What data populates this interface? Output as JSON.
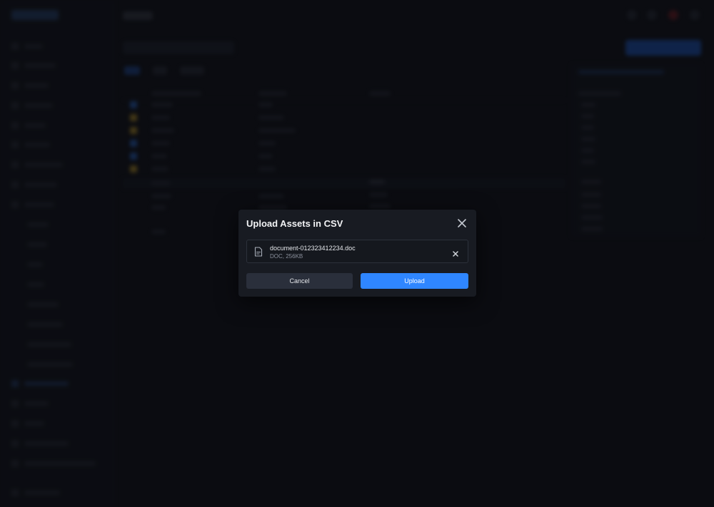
{
  "modal": {
    "title": "Upload Assets in CSV",
    "file": {
      "name": "document-012323412234.doc",
      "meta": "DOC, 256KB"
    },
    "cancel_label": "Cancel",
    "upload_label": "Upload"
  },
  "colors": {
    "accent": "#2f86ff",
    "modal_bg": "#181b22",
    "backdrop": "#0f1116"
  },
  "icons": {
    "close": "close-icon",
    "file": "file-icon",
    "remove": "remove-file-icon"
  }
}
